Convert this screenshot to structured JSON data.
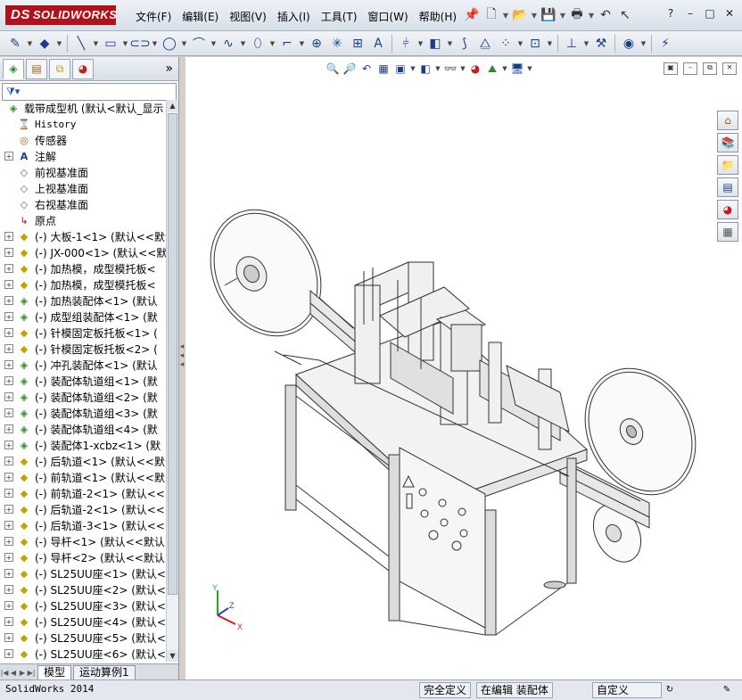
{
  "app": {
    "logo_text": "SOLIDWORKS",
    "logo_prefix": "DS"
  },
  "menu": [
    "文件(F)",
    "编辑(E)",
    "视图(V)",
    "插入(I)",
    "工具(T)",
    "窗口(W)",
    "帮助(H)"
  ],
  "window_controls": [
    "?",
    "–",
    "□",
    "✕"
  ],
  "feature_tree": {
    "root": "载带成型机  (默认<默认_显示",
    "items": [
      {
        "label": "History",
        "icon": "history-icon",
        "expand": "",
        "mono": true
      },
      {
        "label": "传感器",
        "icon": "sensor-icon",
        "expand": ""
      },
      {
        "label": "注解",
        "icon": "annotation-icon",
        "expand": "+"
      },
      {
        "label": "前视基准面",
        "icon": "plane-icon",
        "expand": ""
      },
      {
        "label": "上视基准面",
        "icon": "plane-icon",
        "expand": ""
      },
      {
        "label": "右视基准面",
        "icon": "plane-icon",
        "expand": ""
      },
      {
        "label": "原点",
        "icon": "origin-icon",
        "expand": ""
      },
      {
        "label": "(-) 大板-1<1> (默认<<默认",
        "icon": "part-icon",
        "expand": "+"
      },
      {
        "label": "(-) JX-000<1> (默认<<默认",
        "icon": "part-icon",
        "expand": "+"
      },
      {
        "label": "(-) 加热模，成型模托板<",
        "icon": "part-icon",
        "expand": "+"
      },
      {
        "label": "(-) 加热模，成型模托板<",
        "icon": "part-icon",
        "expand": "+"
      },
      {
        "label": "(-) 加热装配体<1> (默认",
        "icon": "assembly-icon",
        "expand": "+"
      },
      {
        "label": "(-) 成型组装配体<1> (默",
        "icon": "assembly-icon",
        "expand": "+"
      },
      {
        "label": "(-) 针模固定板托板<1> (",
        "icon": "part-icon",
        "expand": "+"
      },
      {
        "label": "(-) 针模固定板托板<2> (",
        "icon": "part-icon",
        "expand": "+"
      },
      {
        "label": "(-) 冲孔装配体<1> (默认",
        "icon": "assembly-icon",
        "expand": "+"
      },
      {
        "label": "(-) 装配体轨道组<1> (默",
        "icon": "assembly-icon",
        "expand": "+"
      },
      {
        "label": "(-) 装配体轨道组<2> (默",
        "icon": "assembly-icon",
        "expand": "+"
      },
      {
        "label": "(-) 装配体轨道组<3> (默",
        "icon": "assembly-icon",
        "expand": "+"
      },
      {
        "label": "(-) 装配体轨道组<4> (默",
        "icon": "assembly-icon",
        "expand": "+"
      },
      {
        "label": "(-) 装配体1-xcbz<1> (默",
        "icon": "assembly-icon",
        "expand": "+"
      },
      {
        "label": "(-) 后轨道<1> (默认<<默",
        "icon": "part-icon",
        "expand": "+"
      },
      {
        "label": "(-) 前轨道<1> (默认<<默",
        "icon": "part-icon",
        "expand": "+"
      },
      {
        "label": "(-) 前轨道-2<1> (默认<<",
        "icon": "part-icon",
        "expand": "+"
      },
      {
        "label": "(-) 后轨道-2<1> (默认<<",
        "icon": "part-icon",
        "expand": "+"
      },
      {
        "label": "(-) 后轨道-3<1> (默认<<",
        "icon": "part-icon",
        "expand": "+"
      },
      {
        "label": "(-) 导杆<1> (默认<<默认",
        "icon": "part-icon",
        "expand": "+"
      },
      {
        "label": "(-) 导杆<2> (默认<<默认",
        "icon": "part-icon",
        "expand": "+"
      },
      {
        "label": "(-) SL25UU座<1> (默认<<",
        "icon": "part-icon",
        "expand": "+"
      },
      {
        "label": "(-) SL25UU座<2> (默认<<",
        "icon": "part-icon",
        "expand": "+"
      },
      {
        "label": "(-) SL25UU座<3> (默认<<",
        "icon": "part-icon",
        "expand": "+"
      },
      {
        "label": "(-) SL25UU座<4> (默认<<",
        "icon": "part-icon",
        "expand": "+"
      },
      {
        "label": "(-) SL25UU座<5> (默认<<",
        "icon": "part-icon",
        "expand": "+"
      },
      {
        "label": "(-) SL25UU座<6> (默认<<",
        "icon": "part-icon",
        "expand": "+"
      }
    ]
  },
  "bottom_tabs": [
    "模型",
    "运动算例1"
  ],
  "triad": {
    "x": "X",
    "y": "Y",
    "z": "Z"
  },
  "status": {
    "app_version": "SolidWorks 2014",
    "definition": "完全定义",
    "mode": "在编辑 装配体",
    "units": "自定义"
  },
  "colors": {
    "logo_red": "#b0121b",
    "part_yellow": "#c8a000",
    "assembly_green": "#2d8a2d",
    "triad_x": "#cc2222",
    "triad_y": "#22aa22",
    "triad_z": "#2244cc"
  }
}
